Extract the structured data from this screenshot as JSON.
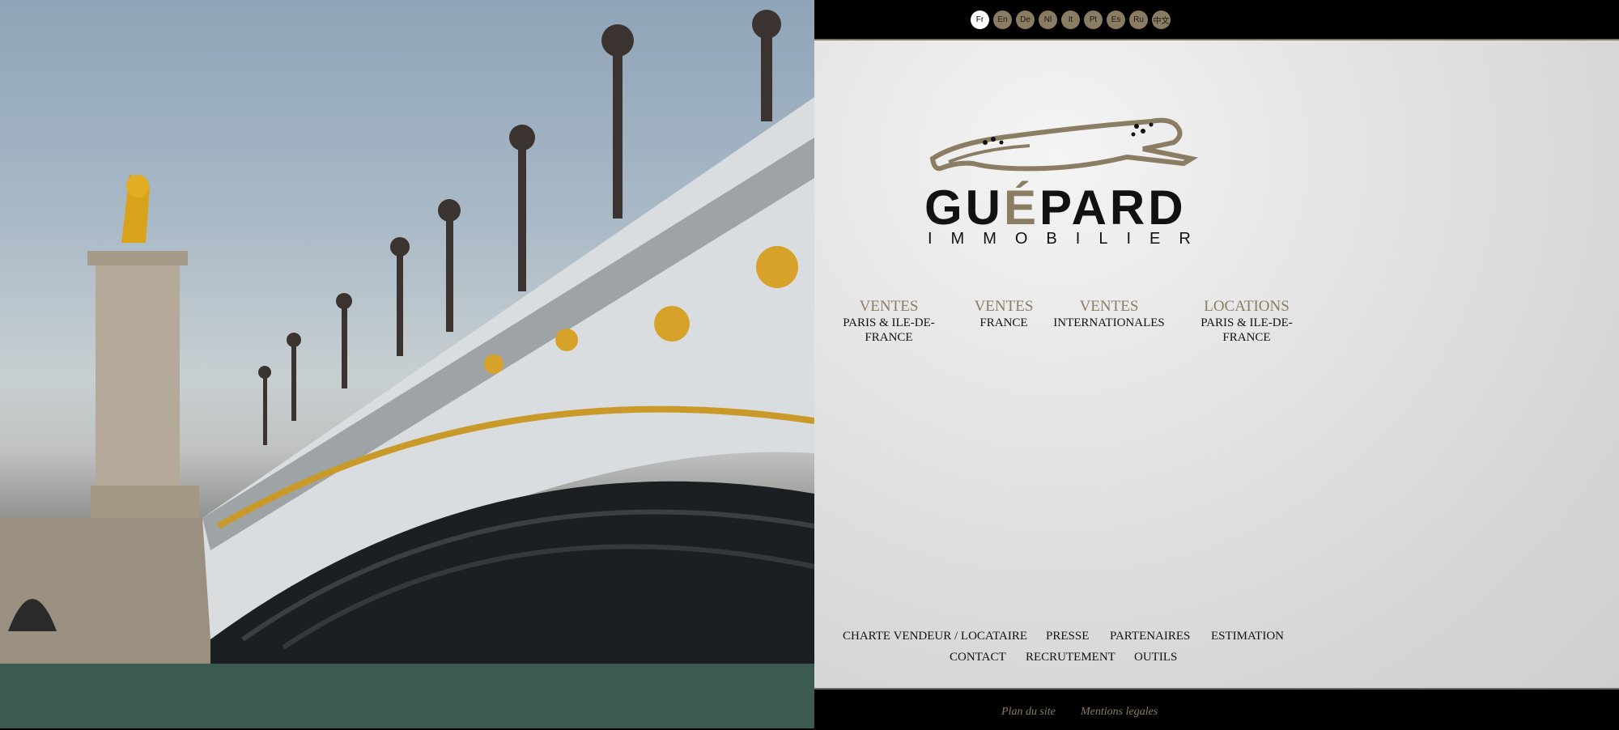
{
  "languages": [
    "Fr",
    "En",
    "De",
    "Nl",
    "It",
    "Pt",
    "Es",
    "Ru",
    "中文"
  ],
  "active_language": "Fr",
  "brand": {
    "name_pre": "GU",
    "name_accent": "É",
    "name_post": "PARD",
    "tagline": "IMMOBILIER"
  },
  "menu": [
    {
      "title": "VENTES",
      "subtitle": "PARIS & ILE-DE-FRANCE"
    },
    {
      "title": "VENTES",
      "subtitle": "FRANCE"
    },
    {
      "title": "VENTES",
      "subtitle": "INTERNATIONALES"
    },
    {
      "title": "LOCATIONS",
      "subtitle": "PARIS & ILE-DE-FRANCE"
    }
  ],
  "footer_links": {
    "charte": "CHARTE VENDEUR / LOCATAIRE",
    "presse": "PRESSE",
    "partenaires": "PARTENAIRES",
    "estimation": "ESTIMATION",
    "contact": "CONTACT",
    "recrutement": "RECRUTEMENT",
    "outils": "OUTILS"
  },
  "bottom_links": {
    "plan": "Plan du site",
    "mentions": "Mentions legales"
  },
  "colors": {
    "accent": "#8a7d64",
    "bar": "#000000",
    "panel": "#dcdcdc"
  },
  "hero_image": "pont-alexandre-iii-bridge-photo"
}
